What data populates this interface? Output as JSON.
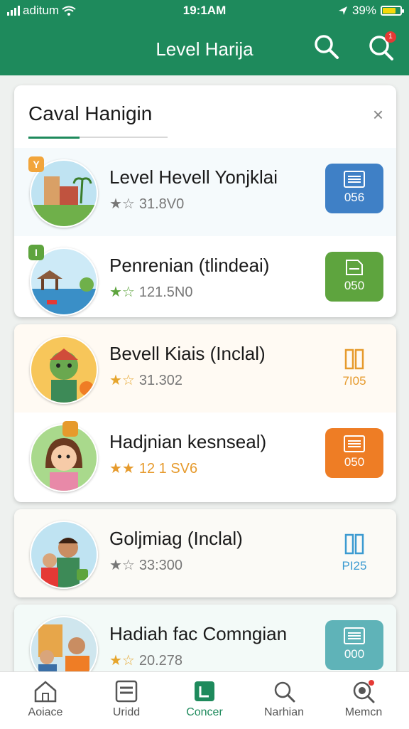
{
  "status_bar": {
    "carrier": "aditum",
    "time": "19:1AM",
    "battery": "39%"
  },
  "app_bar": {
    "title": "Level Harija",
    "notification_count": "1"
  },
  "dialog": {
    "title": "Caval Hanigin",
    "close": "×"
  },
  "items": [
    {
      "name": "Level Hevell Yonjklai",
      "rating": "31.8V0",
      "badge": "Y",
      "action_label": "056",
      "action_color": "#3f80c6"
    },
    {
      "name": "Penrenian (tlindeai)",
      "rating": "121.5N0",
      "badge": "I",
      "action_label": "050",
      "action_color": "#5ea43e"
    },
    {
      "name": "Bevell Kiais (Inclal)",
      "rating": "31.302",
      "badge": "",
      "action_label": "7I05",
      "action_color": "#e69a2c"
    },
    {
      "name": "Hadjnian kesnseal)",
      "rating": "12 1 SV6",
      "badge": "",
      "action_label": "050",
      "action_color": "#ee7d25"
    },
    {
      "name": "Goljmiag (Inclal)",
      "rating": "33:300",
      "badge": "",
      "action_label": "PI25",
      "action_color": "#3b9ad1"
    },
    {
      "name": "Hadiah fac Comngian",
      "rating": "20.278",
      "badge": "",
      "action_label": "000",
      "action_color": "#5fb3b8"
    }
  ],
  "tabs": [
    {
      "label": "Aoiace",
      "icon": "home-icon"
    },
    {
      "label": "Uridd",
      "icon": "list-icon"
    },
    {
      "label": "Concer",
      "icon": "document-icon"
    },
    {
      "label": "Narhian",
      "icon": "search-icon"
    },
    {
      "label": "Memcn",
      "icon": "alert-search-icon"
    }
  ]
}
